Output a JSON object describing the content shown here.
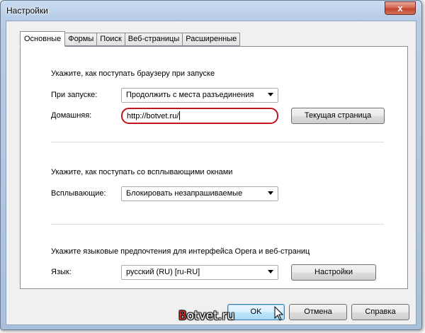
{
  "window": {
    "title": "Настройки",
    "close_label": "x"
  },
  "tabs": [
    {
      "label": "Основные",
      "active": true
    },
    {
      "label": "Формы",
      "active": false
    },
    {
      "label": "Поиск",
      "active": false
    },
    {
      "label": "Веб-страницы",
      "active": false
    },
    {
      "label": "Расширенные",
      "active": false
    }
  ],
  "startup": {
    "heading": "Укажите, как поступать браузеру при запуске",
    "on_start_label": "При запуске:",
    "on_start_value": "Продолжить с места разъединения",
    "home_label": "Домашняя:",
    "home_value": "http://botvet.ru/",
    "current_page_button": "Текущая страница"
  },
  "popups": {
    "heading": "Укажите, как поступать со всплывающими окнами",
    "label": "Всплывающие:",
    "value": "Блокировать незапрашиваемые"
  },
  "language": {
    "heading": "Укажите языковые предпочтения для интерфейса Opera и веб-страниц",
    "label": "Язык:",
    "value": "русский (RU) [ru-RU]",
    "settings_button": "Настройки"
  },
  "footer": {
    "ok": "OK",
    "cancel": "Отмена",
    "help": "Справка"
  },
  "watermark": {
    "first_letter": "B",
    "rest": "otvet.ru"
  },
  "colors": {
    "highlight_ring": "#c0161e",
    "title_bar": "#b7cce6",
    "close_button": "#c2442c"
  }
}
